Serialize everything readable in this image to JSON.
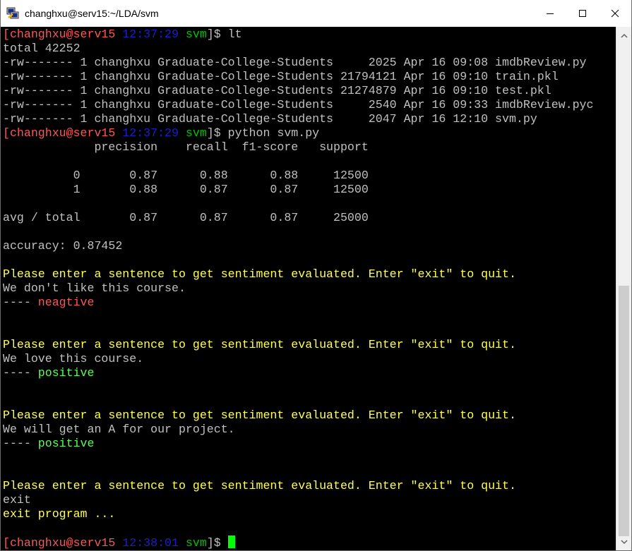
{
  "window": {
    "title": "changhxu@serv15:~/LDA/svm",
    "app_icon": "putty-icon",
    "minimize_icon": "minimize-icon",
    "maximize_icon": "maximize-icon",
    "close_icon": "close-icon"
  },
  "colors": {
    "background": "#000000",
    "text_default": "#c0c0c0",
    "prompt_red": "#ff5555",
    "prompt_time_blue": "#1e1ec8",
    "prompt_dir_green": "#00c000",
    "prompt_default": "#c0c0c0",
    "yellow": "#ffff55",
    "green": "#55ff55",
    "red": "#ff5555",
    "cursor": "#00ff00"
  },
  "terminal": {
    "lines": [
      [
        {
          "t": "[changhxu@serv15 ",
          "c": "prompt_red"
        },
        {
          "t": "12:37:29",
          "c": "prompt_time_blue"
        },
        {
          "t": " svm",
          "c": "prompt_dir_green"
        },
        {
          "t": "]$ lt",
          "c": "prompt_default"
        }
      ],
      [
        {
          "t": "total 42252",
          "c": "text_default"
        }
      ],
      [
        {
          "t": "-rw------- 1 changhxu Graduate-College-Students     2025 Apr 16 09:08 imdbReview.py",
          "c": "text_default"
        }
      ],
      [
        {
          "t": "-rw------- 1 changhxu Graduate-College-Students 21794121 Apr 16 09:10 train.pkl",
          "c": "text_default"
        }
      ],
      [
        {
          "t": "-rw------- 1 changhxu Graduate-College-Students 21274879 Apr 16 09:10 test.pkl",
          "c": "text_default"
        }
      ],
      [
        {
          "t": "-rw------- 1 changhxu Graduate-College-Students     2540 Apr 16 09:33 imdbReview.pyc",
          "c": "text_default"
        }
      ],
      [
        {
          "t": "-rw------- 1 changhxu Graduate-College-Students     2047 Apr 16 12:10 svm.py",
          "c": "text_default"
        }
      ],
      [
        {
          "t": "[changhxu@serv15 ",
          "c": "prompt_red"
        },
        {
          "t": "12:37:29",
          "c": "prompt_time_blue"
        },
        {
          "t": " svm",
          "c": "prompt_dir_green"
        },
        {
          "t": "]$ python svm.py",
          "c": "prompt_default"
        }
      ],
      [
        {
          "t": "             precision    recall  f1-score   support",
          "c": "text_default"
        }
      ],
      [],
      [
        {
          "t": "          0       0.87      0.88      0.88     12500",
          "c": "text_default"
        }
      ],
      [
        {
          "t": "          1       0.88      0.87      0.87     12500",
          "c": "text_default"
        }
      ],
      [],
      [
        {
          "t": "avg / total       0.87      0.87      0.87     25000",
          "c": "text_default"
        }
      ],
      [],
      [
        {
          "t": "accuracy: 0.87452",
          "c": "text_default"
        }
      ],
      [],
      [
        {
          "t": "Please enter a sentence to get sentiment evaluated. Enter \"exit\" to quit.",
          "c": "yellow"
        }
      ],
      [
        {
          "t": "We don't like this course.",
          "c": "text_default"
        }
      ],
      [
        {
          "t": "---- ",
          "c": "text_default"
        },
        {
          "t": "neagtive",
          "c": "red"
        }
      ],
      [],
      [],
      [
        {
          "t": "Please enter a sentence to get sentiment evaluated. Enter \"exit\" to quit.",
          "c": "yellow"
        }
      ],
      [
        {
          "t": "We love this course.",
          "c": "text_default"
        }
      ],
      [
        {
          "t": "---- ",
          "c": "text_default"
        },
        {
          "t": "positive",
          "c": "green"
        }
      ],
      [],
      [],
      [
        {
          "t": "Please enter a sentence to get sentiment evaluated. Enter \"exit\" to quit.",
          "c": "yellow"
        }
      ],
      [
        {
          "t": "We will get an A for our project.",
          "c": "text_default"
        }
      ],
      [
        {
          "t": "---- ",
          "c": "text_default"
        },
        {
          "t": "positive",
          "c": "green"
        }
      ],
      [],
      [],
      [
        {
          "t": "Please enter a sentence to get sentiment evaluated. Enter \"exit\" to quit.",
          "c": "yellow"
        }
      ],
      [
        {
          "t": "exit",
          "c": "text_default"
        }
      ],
      [
        {
          "t": "exit program ...",
          "c": "yellow"
        }
      ],
      [],
      [
        {
          "t": "[changhxu@serv15 ",
          "c": "prompt_red"
        },
        {
          "t": "12:38:01",
          "c": "prompt_time_blue"
        },
        {
          "t": " svm",
          "c": "prompt_dir_green"
        },
        {
          "t": "]$ ",
          "c": "prompt_default"
        }
      ]
    ]
  }
}
